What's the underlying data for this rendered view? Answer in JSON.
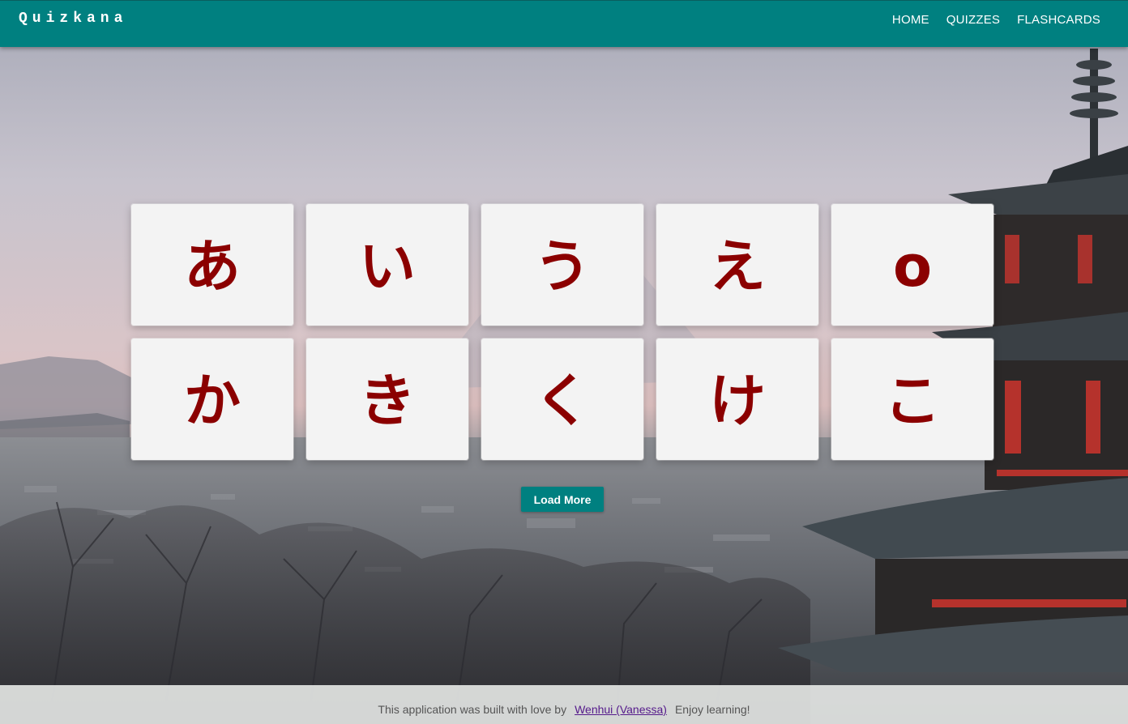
{
  "brand": "Quizkana",
  "nav": {
    "home": "HOME",
    "quizzes": "QUIZZES",
    "flashcards": "FLASHCARDS"
  },
  "cards": [
    "あ",
    "い",
    "う",
    "え",
    "o",
    "か",
    "き",
    "く",
    "け",
    "こ"
  ],
  "load_more_label": "Load More",
  "footer": {
    "text_before": "This application was built with love by",
    "author_link": "Wenhui (Vanessa)",
    "text_after": "Enjoy learning!"
  },
  "colors": {
    "nav_bg": "#008080",
    "card_char": "#8b0000",
    "card_bg": "#f3f3f3",
    "button_bg": "#008080"
  }
}
